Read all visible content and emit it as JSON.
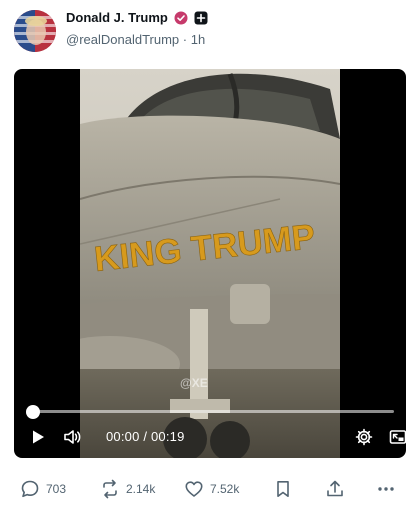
{
  "post": {
    "author_name": "Donald J. Trump",
    "handle": "@realDonaldTrump",
    "separator": "·",
    "time_ago": "1h"
  },
  "video": {
    "fuselage_text": "KING TRUMP",
    "watermark": "@XE",
    "current_time": "00:00",
    "duration": "00:19",
    "time_display": "00:00 / 00:19",
    "progress": 0.0
  },
  "actions": {
    "replies": "703",
    "reposts": "2.14k",
    "likes": "7.52k"
  },
  "colors": {
    "accent": "#1d9bf0",
    "verified_badge": "#c63a6b",
    "muted_text": "#536471"
  }
}
